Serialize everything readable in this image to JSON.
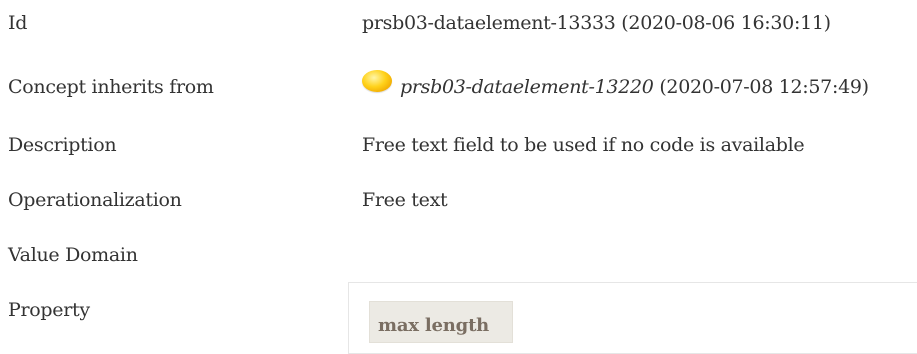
{
  "rows": {
    "id": {
      "label": "Id",
      "value": "prsb03-dataelement-13333 (2020-08-06 16:30:11)"
    },
    "inherits": {
      "label": "Concept inherits from",
      "icon": "concept-yellow-icon",
      "link": "prsb03-dataelement-13220",
      "timestamp": " (2020-07-08 12:57:49)"
    },
    "description": {
      "label": "Description",
      "value": "Free text field to be used if no code is available"
    },
    "operationalization": {
      "label": "Operationalization",
      "value": "Free text"
    },
    "value_domain": {
      "label": "Value Domain"
    },
    "property": {
      "label": "Property"
    }
  },
  "property_table": {
    "header": "max length"
  }
}
